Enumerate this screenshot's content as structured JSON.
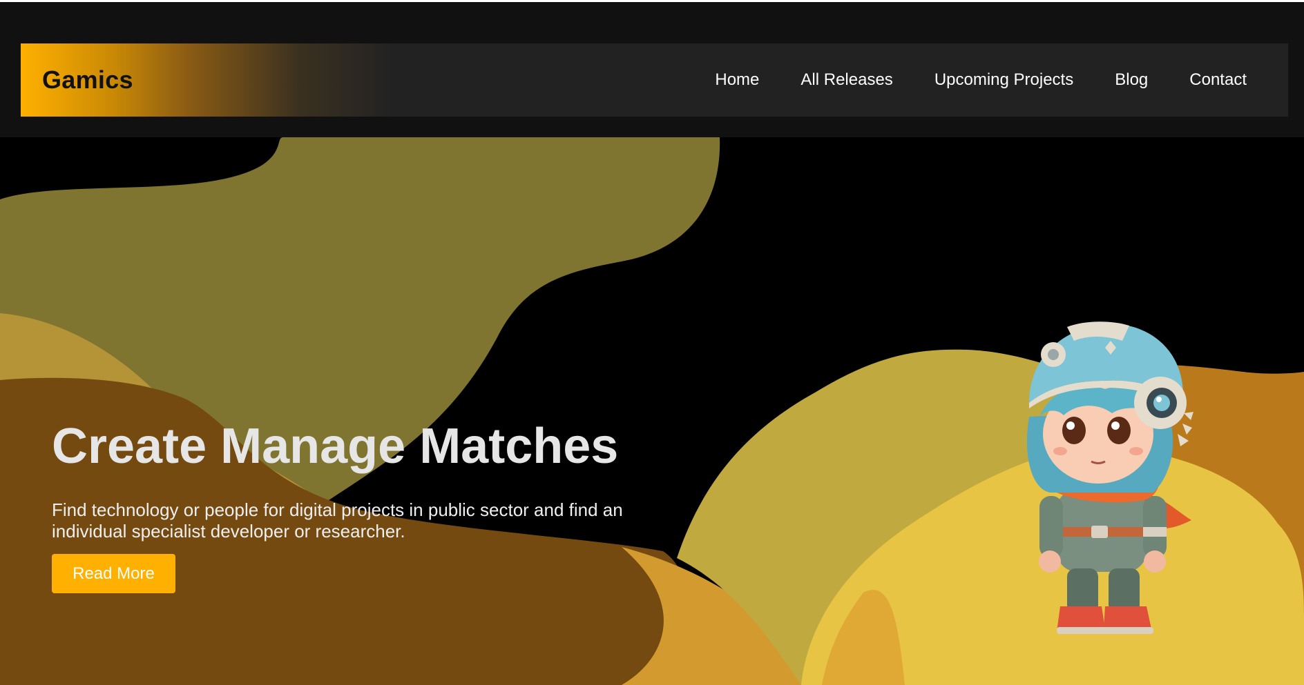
{
  "brand": {
    "name": "Gamics"
  },
  "nav": {
    "items": [
      {
        "label": "Home"
      },
      {
        "label": "All Releases"
      },
      {
        "label": "Upcoming Projects"
      },
      {
        "label": "Blog"
      },
      {
        "label": "Contact"
      }
    ]
  },
  "hero": {
    "title": "Create Manage Matches",
    "subtitle": "Find technology or people for digital projects in public sector and find an individual specialist developer or researcher.",
    "cta_label": "Read More"
  },
  "colors": {
    "accent": "#ffb000",
    "header_bg": "#111111",
    "navbar_bg": "#222222",
    "blob_olive": "#807530",
    "blob_brown": "#744a10",
    "blob_gold": "#c0aa40",
    "blob_orange": "#ba7a1c",
    "blob_yellow": "#e8c444"
  },
  "icons": {
    "mascot": "chibi-astronaut-girl-illustration"
  }
}
